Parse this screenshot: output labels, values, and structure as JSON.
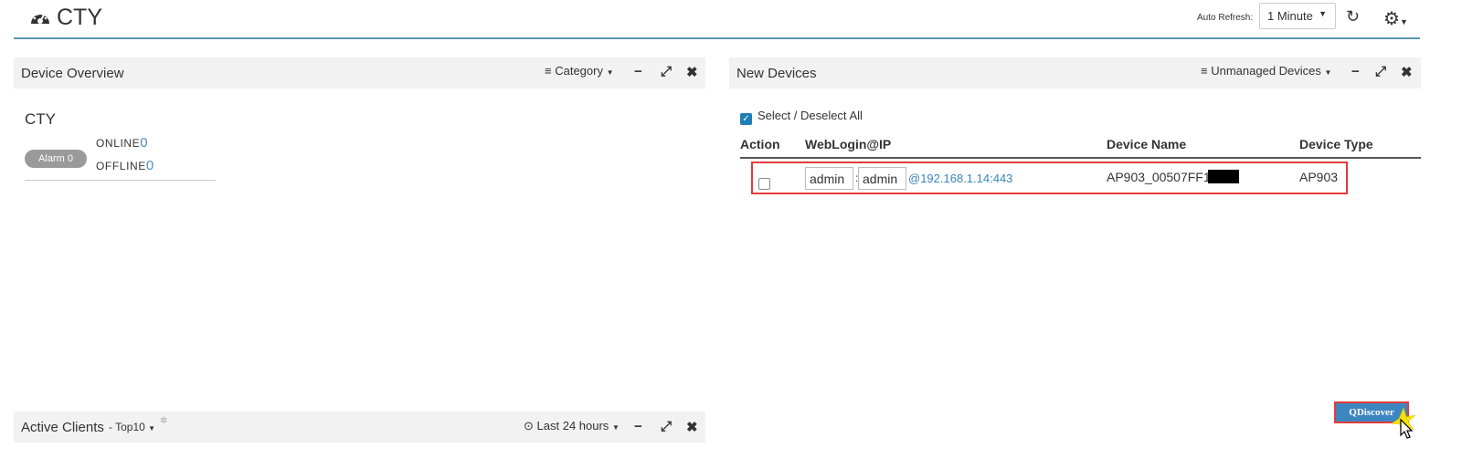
{
  "header": {
    "title": "CTY",
    "auto_refresh_label": "Auto Refresh:",
    "refresh_interval": "1 Minute",
    "icons": [
      "dashboard-icon",
      "refresh-icon",
      "gear-icon"
    ]
  },
  "device_overview": {
    "title": "Device Overview",
    "view_menu": "Category",
    "site_name": "CTY",
    "alarm": "Alarm 0",
    "online_label": "ONLINE",
    "online_count": "0",
    "offline_label": "OFFLINE",
    "offline_count": "0"
  },
  "new_devices": {
    "title": "New Devices",
    "filter_menu": "Unmanaged Devices",
    "select_all_label": "Select / Deselect All",
    "columns": [
      "Action",
      "WebLogin@IP",
      "Device Name",
      "Device Type"
    ],
    "rows": [
      {
        "username": "admin",
        "password": "admin",
        "ip": "@192.168.1.14:443",
        "device_name": "AP903_00507FF1",
        "device_type": "AP903"
      }
    ],
    "discover_label": "Discover"
  },
  "active_clients": {
    "title": "Active Clients",
    "top_menu": "- Top10",
    "range_menu": "Last 24 hours"
  },
  "colors": {
    "accent": "#5b94b5",
    "link": "#3a86b9",
    "highlight": "#e33b3b",
    "button": "#3d87c1"
  }
}
